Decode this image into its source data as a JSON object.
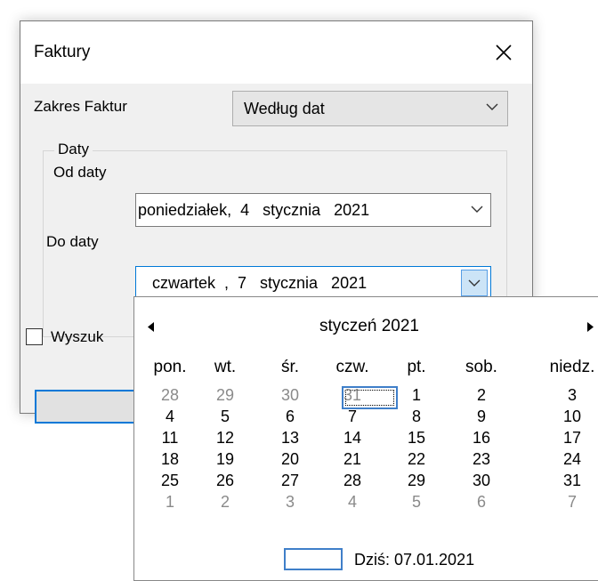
{
  "window": {
    "title": "Faktury"
  },
  "form": {
    "range_label": "Zakres Faktur",
    "range_value": "Według dat",
    "group_caption": "Daty",
    "from_label": "Od daty",
    "from_value": "poniedziałek,  4   stycznia   2021",
    "to_label": "Do daty",
    "to_value": "czwartek  ,  7   stycznia   2021",
    "checkbox_label": "Wyszuk",
    "checkbox_checked": false
  },
  "calendar": {
    "month_title": "styczeń 2021",
    "weekdays": [
      "pon.",
      "wt.",
      "śr.",
      "czw.",
      "pt.",
      "sob.",
      "niedz."
    ],
    "weeks": [
      [
        "28",
        "29",
        "30",
        "31",
        "1",
        "2",
        "3"
      ],
      [
        "4",
        "5",
        "6",
        "7",
        "8",
        "9",
        "10"
      ],
      [
        "11",
        "12",
        "13",
        "14",
        "15",
        "16",
        "17"
      ],
      [
        "18",
        "19",
        "20",
        "21",
        "22",
        "23",
        "24"
      ],
      [
        "25",
        "26",
        "27",
        "28",
        "29",
        "30",
        "31"
      ],
      [
        "1",
        "2",
        "3",
        "4",
        "5",
        "6",
        "7"
      ]
    ],
    "selected_day": "7",
    "today_label": "Dziś: 07.01.2021",
    "accent_color": "#0078d7"
  }
}
